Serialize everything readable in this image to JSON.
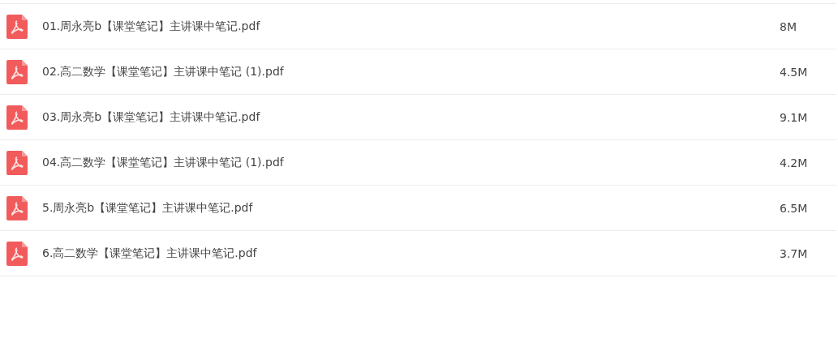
{
  "files": [
    {
      "name": "01.周永亮b【课堂笔记】主讲课中笔记.pdf",
      "size": "8M"
    },
    {
      "name": "02.高二数学【课堂笔记】主讲课中笔记 (1).pdf",
      "size": "4.5M"
    },
    {
      "name": "03.周永亮b【课堂笔记】主讲课中笔记.pdf",
      "size": "9.1M"
    },
    {
      "name": "04.高二数学【课堂笔记】主讲课中笔记 (1).pdf",
      "size": "4.2M"
    },
    {
      "name": "5.周永亮b【课堂笔记】主讲课中笔记.pdf",
      "size": "6.5M"
    },
    {
      "name": "6.高二数学【课堂笔记】主讲课中笔记.pdf",
      "size": "3.7M"
    }
  ]
}
